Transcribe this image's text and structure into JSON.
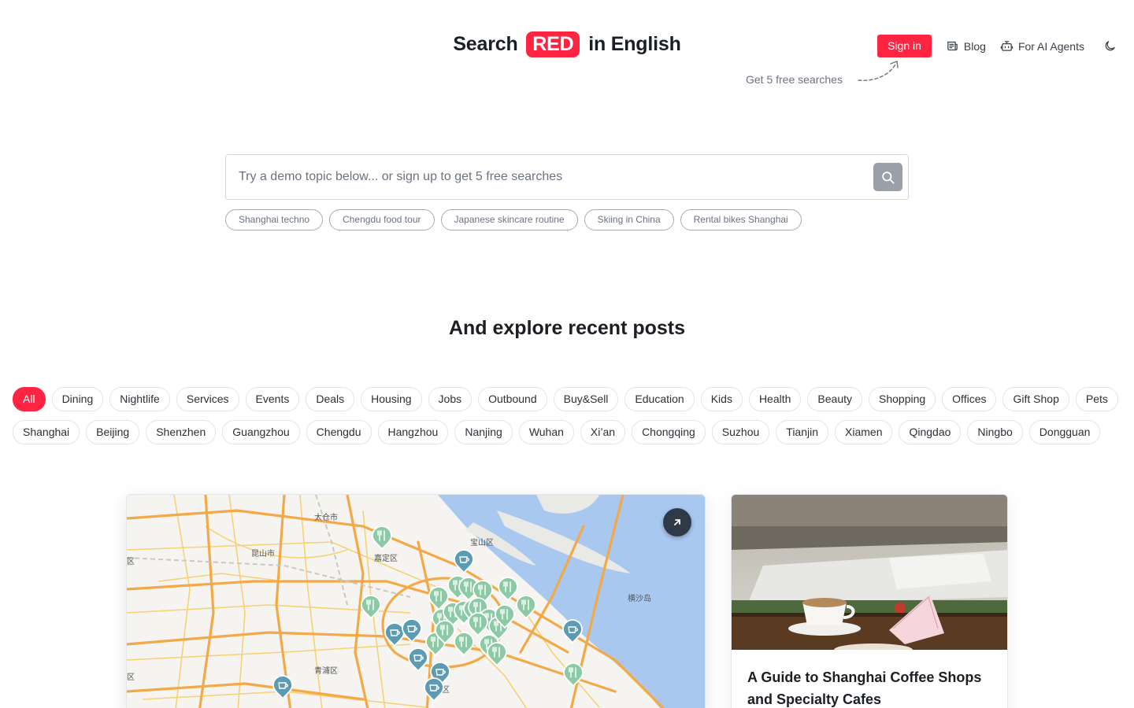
{
  "header": {
    "logo_prefix": "Search",
    "logo_badge": "RED",
    "logo_suffix": "in English",
    "signin_label": "Sign in",
    "blog_label": "Blog",
    "agents_label": "For AI Agents",
    "hint": "Get 5 free searches"
  },
  "search": {
    "placeholder": "Try a demo topic below... or sign up to get 5 free searches",
    "demo_topics": [
      "Shanghai techno",
      "Chengdu food tour",
      "Japanese skincare routine",
      "Skiing in China",
      "Rental bikes Shanghai"
    ]
  },
  "explore": {
    "title": "And explore recent posts",
    "categories": [
      "All",
      "Dining",
      "Nightlife",
      "Services",
      "Events",
      "Deals",
      "Housing",
      "Jobs",
      "Outbound",
      "Buy&Sell",
      "Education",
      "Kids",
      "Health",
      "Beauty",
      "Shopping",
      "Offices",
      "Gift Shop",
      "Pets"
    ],
    "active_category": "All",
    "cities": [
      "Shanghai",
      "Beijing",
      "Shenzhen",
      "Guangzhou",
      "Chengdu",
      "Hangzhou",
      "Nanjing",
      "Wuhan",
      "Xi’an",
      "Chongqing",
      "Suzhou",
      "Tianjin",
      "Xiamen",
      "Qingdao",
      "Ningbo",
      "Dongguan"
    ]
  },
  "map": {
    "labels": [
      "太仓市",
      "宝山区",
      "昆山市",
      "嘉定区",
      "横沙岛",
      "青浦区",
      "区",
      "区",
      "区"
    ]
  },
  "post": {
    "title": "A Guide to Shanghai Coffee Shops and Specialty Cafes"
  },
  "colors": {
    "accent": "#ff2442",
    "dining_pin": "#8ccaa6",
    "cafe_pin": "#5b9bb3",
    "water": "#a9c8f0",
    "road_major": "#f3a947",
    "road_minor": "#f6d276"
  }
}
